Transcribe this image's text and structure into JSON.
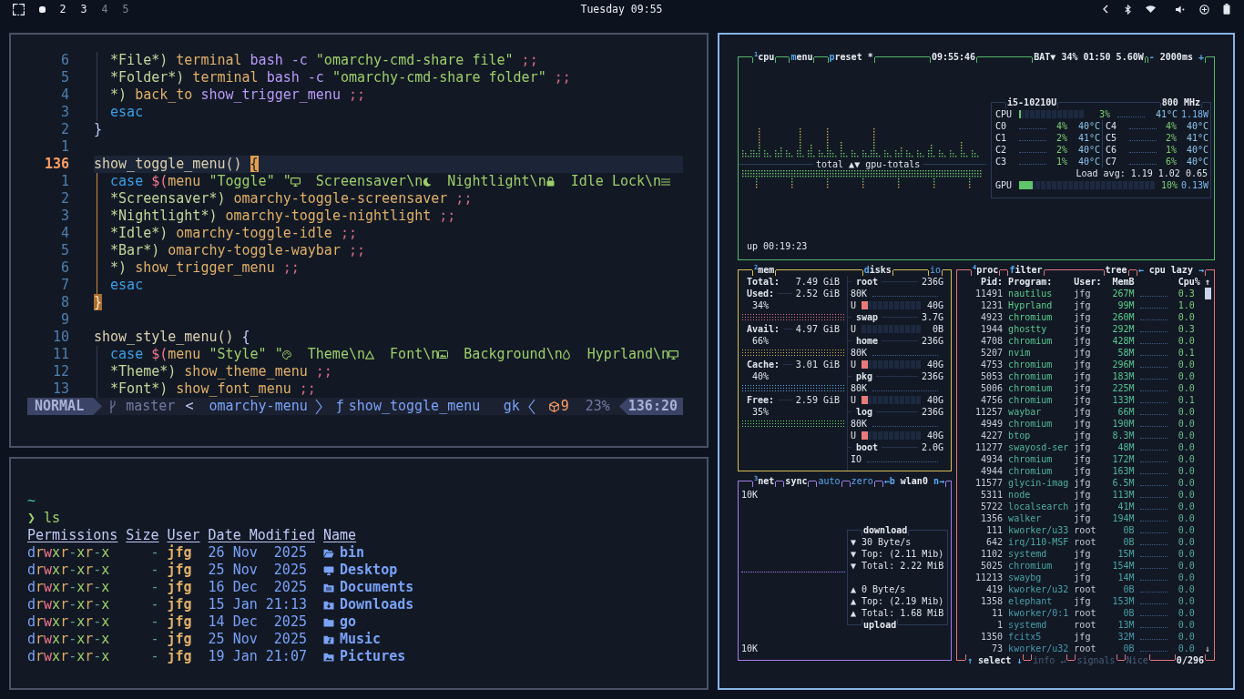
{
  "top_bar": {
    "workspaces": [
      {
        "selected": true,
        "occupied": true
      },
      {
        "label": "2",
        "selected": false,
        "occupied": true
      },
      {
        "label": "3",
        "selected": false,
        "occupied": true
      },
      {
        "label": "4",
        "selected": false,
        "occupied": false
      },
      {
        "label": "5",
        "selected": false,
        "occupied": false
      }
    ],
    "clock": "Tuesday 09:55"
  },
  "editor": {
    "lines": [
      {
        "number": "6",
        "current": false,
        "indent_guide": true,
        "guide_active": false,
        "tokens": [
          {
            "kind": "pattern",
            "text": "*File*)"
          },
          {
            "kind": "command",
            "text": " terminal"
          },
          {
            "kind": "argument",
            "text": " bash -c"
          },
          {
            "kind": "string",
            "text": " \"omarchy-cmd-share file\""
          },
          {
            "kind": "separator",
            "text": " ;;"
          }
        ]
      },
      {
        "number": "5",
        "current": false,
        "indent_guide": true,
        "guide_active": false,
        "tokens": [
          {
            "kind": "pattern",
            "text": "*Folder*)"
          },
          {
            "kind": "command",
            "text": " terminal"
          },
          {
            "kind": "argument",
            "text": " bash -c"
          },
          {
            "kind": "string",
            "text": " \"omarchy-cmd-share folder\""
          },
          {
            "kind": "separator",
            "text": " ;;"
          }
        ]
      },
      {
        "number": "4",
        "current": false,
        "indent_guide": true,
        "guide_active": false,
        "tokens": [
          {
            "kind": "pattern",
            "text": "*)"
          },
          {
            "kind": "command",
            "text": " back_to"
          },
          {
            "kind": "argument",
            "text": " show_trigger_menu"
          },
          {
            "kind": "separator",
            "text": " ;;"
          }
        ]
      },
      {
        "number": "3",
        "current": false,
        "indent_guide": true,
        "guide_active": false,
        "tokens": [
          {
            "kind": "keyword",
            "text": "esac"
          }
        ]
      },
      {
        "number": "2",
        "current": false,
        "indent_guide": false,
        "tokens": [
          {
            "kind": "plain",
            "text": "}"
          }
        ]
      },
      {
        "number": "1",
        "current": false,
        "indent_guide": false
      },
      {
        "number": "136",
        "current": true,
        "indent_guide": false,
        "tokens": [
          {
            "kind": "function",
            "text": "show_toggle_menu()"
          },
          {
            "kind": "cursor",
            "text": " {"
          }
        ]
      },
      {
        "number": "1",
        "current": false,
        "indent_guide": true,
        "guide_active": true,
        "tokens": [
          {
            "kind": "keyword",
            "text": "case"
          },
          {
            "kind": "subshell",
            "text": " $("
          },
          {
            "kind": "command",
            "text": "menu"
          },
          {
            "kind": "string",
            "text": " \"Toggle\" \""
          },
          {
            "kind": "monitor"
          },
          {
            "kind": "string",
            "text": "  Screensaver\\n"
          },
          {
            "kind": "moon"
          },
          {
            "kind": "string",
            "text": "  Nightlight\\n"
          },
          {
            "kind": "lock"
          },
          {
            "kind": "string",
            "text": "  Idle Lock\\n"
          },
          {
            "kind": "bars"
          }
        ]
      },
      {
        "number": "2",
        "current": false,
        "indent_guide": true,
        "guide_active": true,
        "tokens": [
          {
            "kind": "pattern",
            "text": "*Screensaver*)"
          },
          {
            "kind": "command",
            "text": " omarchy-toggle-screensaver"
          },
          {
            "kind": "separator",
            "text": " ;;"
          }
        ]
      },
      {
        "number": "3",
        "current": false,
        "indent_guide": true,
        "guide_active": true,
        "tokens": [
          {
            "kind": "pattern",
            "text": "*Nightlight*)"
          },
          {
            "kind": "command",
            "text": " omarchy-toggle-nightlight"
          },
          {
            "kind": "separator",
            "text": " ;;"
          }
        ]
      },
      {
        "number": "4",
        "current": false,
        "indent_guide": true,
        "guide_active": true,
        "tokens": [
          {
            "kind": "pattern",
            "text": "*Idle*)"
          },
          {
            "kind": "command",
            "text": " omarchy-toggle-idle"
          },
          {
            "kind": "separator",
            "text": " ;;"
          }
        ]
      },
      {
        "number": "5",
        "current": false,
        "indent_guide": true,
        "guide_active": true,
        "tokens": [
          {
            "kind": "pattern",
            "text": "*Bar*)"
          },
          {
            "kind": "command",
            "text": " omarchy-toggle-waybar"
          },
          {
            "kind": "separator",
            "text": " ;;"
          }
        ]
      },
      {
        "number": "6",
        "current": false,
        "indent_guide": true,
        "guide_active": true,
        "tokens": [
          {
            "kind": "pattern",
            "text": "*)"
          },
          {
            "kind": "command",
            "text": " show_trigger_menu"
          },
          {
            "kind": "separator",
            "text": " ;;"
          }
        ]
      },
      {
        "number": "7",
        "current": false,
        "indent_guide": true,
        "guide_active": true,
        "tokens": [
          {
            "kind": "keyword",
            "text": "esac"
          }
        ]
      },
      {
        "number": "8",
        "current": false,
        "indent_guide": false,
        "tokens": [
          {
            "kind": "match",
            "text": "}"
          }
        ]
      },
      {
        "number": "9",
        "current": false,
        "indent_guide": false
      },
      {
        "number": "10",
        "current": false,
        "indent_guide": false,
        "tokens": [
          {
            "kind": "function",
            "text": "show_style_menu()"
          },
          {
            "kind": "plain",
            "text": " {"
          }
        ]
      },
      {
        "number": "11",
        "current": false,
        "indent_guide": true,
        "guide_active": false,
        "tokens": [
          {
            "kind": "keyword",
            "text": "case"
          },
          {
            "kind": "subshell",
            "text": " $("
          },
          {
            "kind": "command",
            "text": "menu"
          },
          {
            "kind": "string",
            "text": " \"Style\" \""
          },
          {
            "kind": "palette"
          },
          {
            "kind": "string",
            "text": "  Theme\\n"
          },
          {
            "kind": "triangle"
          },
          {
            "kind": "string",
            "text": "  Font\\n"
          },
          {
            "kind": "image"
          },
          {
            "kind": "string",
            "text": "  Background\\n"
          },
          {
            "kind": "droplet"
          },
          {
            "kind": "string",
            "text": "  Hyprland\\n"
          },
          {
            "kind": "monitor"
          }
        ]
      },
      {
        "number": "12",
        "current": false,
        "indent_guide": true,
        "guide_active": false,
        "tokens": [
          {
            "kind": "pattern",
            "text": "*Theme*)"
          },
          {
            "kind": "command",
            "text": " show_theme_menu"
          },
          {
            "kind": "separator",
            "text": " ;;"
          }
        ]
      },
      {
        "number": "13",
        "current": false,
        "indent_guide": true,
        "guide_active": false,
        "tokens": [
          {
            "kind": "pattern",
            "text": "*Font*)"
          },
          {
            "kind": "command",
            "text": " show_font_menu"
          },
          {
            "kind": "separator",
            "text": " ;;"
          }
        ]
      }
    ],
    "status_line": {
      "mode": "NORMAL",
      "branch": "master",
      "separator": "<",
      "file": "omarchy-menu",
      "function_marker": "ƒ",
      "function": "show_toggle_menu",
      "keys": "gk",
      "diagnostics": "9",
      "progress": "23%",
      "position": "136:20"
    }
  },
  "terminal": {
    "cwd": "~",
    "prompt": "❯",
    "command": "ls",
    "columns": [
      "Permissions",
      "Size",
      "User",
      "Date Modified",
      "Name"
    ],
    "rows": [
      {
        "permissions": "drwxr-xr-x",
        "size": "-",
        "user": "jfg",
        "date": "26 Nov  2025",
        "kind": "open",
        "name": "bin"
      },
      {
        "permissions": "drwxr-xr-x",
        "size": "-",
        "user": "jfg",
        "date": "25 Nov  2025",
        "kind": "desktop",
        "name": "Desktop"
      },
      {
        "permissions": "drwxr-xr-x",
        "size": "-",
        "user": "jfg",
        "date": "16 Dec  2025",
        "kind": "documents",
        "name": "Documents"
      },
      {
        "permissions": "drwxr-xr-x",
        "size": "-",
        "user": "jfg",
        "date": "15 Jan 21:13",
        "kind": "downloads",
        "name": "Downloads"
      },
      {
        "permissions": "drwxr-xr-x",
        "size": "-",
        "user": "jfg",
        "date": "14 Dec  2025",
        "kind": "folder",
        "name": "go"
      },
      {
        "permissions": "drwxr-xr-x",
        "size": "-",
        "user": "jfg",
        "date": "25 Nov  2025",
        "kind": "music",
        "name": "Music"
      },
      {
        "permissions": "drwxr-xr-x",
        "size": "-",
        "user": "jfg",
        "date": "19 Jan 21:07",
        "kind": "pictures",
        "name": "Pictures"
      }
    ]
  },
  "btop": {
    "cpu": {
      "header_left": [
        {
          "text": "$^{1}$cpu",
          "highlighted": false
        },
        {
          "text": "**m**enu",
          "highlighted": false
        },
        {
          "text": "**p**reset *",
          "highlighted": false
        }
      ],
      "header_center": [
        {
          "text": "09:55:46",
          "highlighted": false
        }
      ],
      "header_right": [
        {
          "text": "BAT▼ 34% 01:50 5.60W",
          "highlighted": false
        },
        {
          "text": "**-** 2000ms **+**",
          "highlighted": false
        }
      ],
      "graph_label": "total ▲▼ gpu-totals",
      "uptime": "up 00:19:23",
      "info": {
        "model": "i5-10210U",
        "frequency": "800 MHz",
        "total": {
          "label": "CPU",
          "level": 0.03,
          "percent": "3%",
          "temperature": "41°C",
          "power": "1.18W"
        },
        "cores": [
          {
            "label": "C0",
            "percent": "4%",
            "temperature": "40°C"
          },
          {
            "label": "C1",
            "percent": "2%",
            "temperature": "41°C"
          },
          {
            "label": "C2",
            "percent": "2%",
            "temperature": "40°C"
          },
          {
            "label": "C3",
            "percent": "1%",
            "temperature": "40°C"
          },
          {
            "label": "C4",
            "percent": "4%",
            "temperature": "40°C"
          },
          {
            "label": "C5",
            "percent": "2%",
            "temperature": "41°C"
          },
          {
            "label": "C6",
            "percent": "1%",
            "temperature": "40°C"
          },
          {
            "label": "C7",
            "percent": "6%",
            "temperature": "40°C"
          }
        ],
        "load": "Load avg: 1.19 1.02 0.65",
        "gpu": {
          "label": "GPU",
          "level": 0.1,
          "percent": "10%",
          "power": "0.13W"
        }
      }
    },
    "mem": {
      "header_left": [
        {
          "text": "$^{2}$mem",
          "highlighted": false
        }
      ],
      "header_right": [
        {
          "text": "**d**isks",
          "highlighted": false
        },
        {
          "text": "io",
          "highlighted": true
        }
      ],
      "total": {
        "label": "Total:",
        "value": "7.49 GiB"
      },
      "items": [
        {
          "label": "Used:",
          "value": "2.52 GiB",
          "percent": "34%",
          "color": "#e0707a"
        },
        {
          "label": "Avail:",
          "value": "4.97 GiB",
          "percent": "66%",
          "color": "#d8b040"
        },
        {
          "label": "Cache:",
          "value": "3.01 GiB",
          "percent": "40%",
          "color": "#5aaee8"
        },
        {
          "label": "Free:",
          "value": "2.59 GiB",
          "percent": "35%",
          "color": "#6ee06e"
        }
      ],
      "disks": [
        {
          "kind": "name",
          "name": "root",
          "size": "236G"
        },
        {
          "kind": "io",
          "label": "80K"
        },
        {
          "kind": "usage",
          "label": "U",
          "level": 0.1,
          "value": "40G"
        },
        {
          "kind": "name",
          "name": "swap",
          "size": "3.7G"
        },
        {
          "kind": "usage",
          "label": "U",
          "level": 0,
          "value": "0B"
        },
        {
          "kind": "name",
          "name": "home",
          "size": "236G"
        },
        {
          "kind": "io",
          "label": "80K"
        },
        {
          "kind": "usage",
          "label": "U",
          "level": 0.1,
          "value": "40G"
        },
        {
          "kind": "name",
          "name": "pkg",
          "size": "236G"
        },
        {
          "kind": "io",
          "label": "80K"
        },
        {
          "kind": "usage",
          "label": "U",
          "level": 0.1,
          "value": "40G"
        },
        {
          "kind": "name",
          "name": "log",
          "size": "236G"
        },
        {
          "kind": "io",
          "label": "80K"
        },
        {
          "kind": "usage",
          "label": "U",
          "level": 0.1,
          "value": "40G"
        },
        {
          "kind": "name",
          "name": "boot",
          "size": "2.0G"
        },
        {
          "kind": "io",
          "label": "IO"
        }
      ]
    },
    "net": {
      "header_left": [
        {
          "text": "$^{3}$net",
          "highlighted": false
        },
        {
          "text": "sync",
          "highlighted": false
        },
        {
          "text": "auto",
          "highlighted": true
        },
        {
          "text": "zero",
          "highlighted": true
        },
        {
          "text": "**←b** wlan0 **n→**",
          "highlighted": false
        }
      ],
      "scale_top": "10K",
      "download_title": "download",
      "download": [
        "▼ 30 Byte/s",
        "▼ Top: (2.11 Mib)",
        "▼ Total: 2.22 MiB"
      ],
      "upload": [
        "▲ 0 Byte/s",
        "▲ Top: (2.19 Mib)",
        "▲ Total: 1.68 MiB"
      ],
      "upload_title": "upload",
      "scale_bottom": "10K"
    },
    "proc": {
      "header_left": [
        {
          "text": "$^{4}$proc",
          "highlighted": false
        },
        {
          "text": "**f**ilter",
          "highlighted": false
        }
      ],
      "header_right": [
        {
          "text": "tree",
          "highlighted": false
        },
        {
          "text": "**←** cpu lazy **→**",
          "highlighted": false
        }
      ],
      "columns": [
        "Pid:",
        "Program:",
        "User:",
        "MemB",
        "Cpu%"
      ],
      "sort_arrow": "↑",
      "rows": [
        {
          "pid": "11491",
          "program": "nautilus",
          "user": "jfg",
          "mem": "267M",
          "cpu": "0.3"
        },
        {
          "pid": "1231",
          "program": "Hyprland",
          "user": "jfg",
          "mem": "99M",
          "cpu": "1.0"
        },
        {
          "pid": "4923",
          "program": "chromium",
          "user": "jfg",
          "mem": "260M",
          "cpu": "0.0"
        },
        {
          "pid": "1944",
          "program": "ghostty",
          "user": "jfg",
          "mem": "292M",
          "cpu": "0.3"
        },
        {
          "pid": "4708",
          "program": "chromium",
          "user": "jfg",
          "mem": "428M",
          "cpu": "0.0"
        },
        {
          "pid": "5207",
          "program": "nvim",
          "user": "jfg",
          "mem": "58M",
          "cpu": "0.1"
        },
        {
          "pid": "4753",
          "program": "chromium",
          "user": "jfg",
          "mem": "296M",
          "cpu": "0.0"
        },
        {
          "pid": "5053",
          "program": "chromium",
          "user": "jfg",
          "mem": "183M",
          "cpu": "0.0"
        },
        {
          "pid": "5006",
          "program": "chromium",
          "user": "jfg",
          "mem": "225M",
          "cpu": "0.0"
        },
        {
          "pid": "4756",
          "program": "chromium",
          "user": "jfg",
          "mem": "133M",
          "cpu": "0.1"
        },
        {
          "pid": "11257",
          "program": "waybar",
          "user": "jfg",
          "mem": "66M",
          "cpu": "0.0"
        },
        {
          "pid": "4949",
          "program": "chromium",
          "user": "jfg",
          "mem": "190M",
          "cpu": "0.0"
        },
        {
          "pid": "4227",
          "program": "btop",
          "user": "jfg",
          "mem": "8.3M",
          "cpu": "0.0"
        },
        {
          "pid": "11277",
          "program": "swayosd-ser",
          "user": "jfg",
          "mem": "48M",
          "cpu": "0.0"
        },
        {
          "pid": "4934",
          "program": "chromium",
          "user": "jfg",
          "mem": "172M",
          "cpu": "0.0"
        },
        {
          "pid": "4944",
          "program": "chromium",
          "user": "jfg",
          "mem": "163M",
          "cpu": "0.0"
        },
        {
          "pid": "11577",
          "program": "glycin-imag",
          "user": "jfg",
          "mem": "6.5M",
          "cpu": "0.0"
        },
        {
          "pid": "5311",
          "program": "node",
          "user": "jfg",
          "mem": "113M",
          "cpu": "0.0"
        },
        {
          "pid": "5722",
          "program": "localsearch",
          "user": "jfg",
          "mem": "41M",
          "cpu": "0.0"
        },
        {
          "pid": "1356",
          "program": "walker",
          "user": "jfg",
          "mem": "194M",
          "cpu": "0.0"
        },
        {
          "pid": "111",
          "program": "kworker/u33",
          "user": "root",
          "mem": "0B",
          "cpu": "0.0"
        },
        {
          "pid": "642",
          "program": "irq/110-MSF",
          "user": "root",
          "mem": "0B",
          "cpu": "0.0"
        },
        {
          "pid": "1102",
          "program": "systemd",
          "user": "jfg",
          "mem": "15M",
          "cpu": "0.0"
        },
        {
          "pid": "5025",
          "program": "chromium",
          "user": "jfg",
          "mem": "154M",
          "cpu": "0.0"
        },
        {
          "pid": "11213",
          "program": "swaybg",
          "user": "jfg",
          "mem": "14M",
          "cpu": "0.0"
        },
        {
          "pid": "419",
          "program": "kworker/u32",
          "user": "root",
          "mem": "0B",
          "cpu": "0.0"
        },
        {
          "pid": "1358",
          "program": "elephant",
          "user": "jfg",
          "mem": "153M",
          "cpu": "0.0"
        },
        {
          "pid": "11",
          "program": "kworker/0:1",
          "user": "root",
          "mem": "0B",
          "cpu": "0.0"
        },
        {
          "pid": "1",
          "program": "systemd",
          "user": "root",
          "mem": "13M",
          "cpu": "0.0"
        },
        {
          "pid": "1350",
          "program": "fcitx5",
          "user": "jfg",
          "mem": "32M",
          "cpu": "0.0"
        },
        {
          "pid": "73",
          "program": "kworker/u32",
          "user": "root",
          "mem": "0B",
          "cpu": "0.0"
        }
      ],
      "scroll_down": "↓",
      "footer_left": [
        {
          "text": "**↑** select **↓**",
          "disabled": false
        },
        {
          "text": "info ↵",
          "disabled": true
        },
        {
          "text": "signals",
          "disabled": true
        },
        {
          "text": "Nice",
          "disabled": true
        }
      ],
      "footer_right": [
        {
          "text": "0/296",
          "disabled": false
        }
      ]
    }
  }
}
